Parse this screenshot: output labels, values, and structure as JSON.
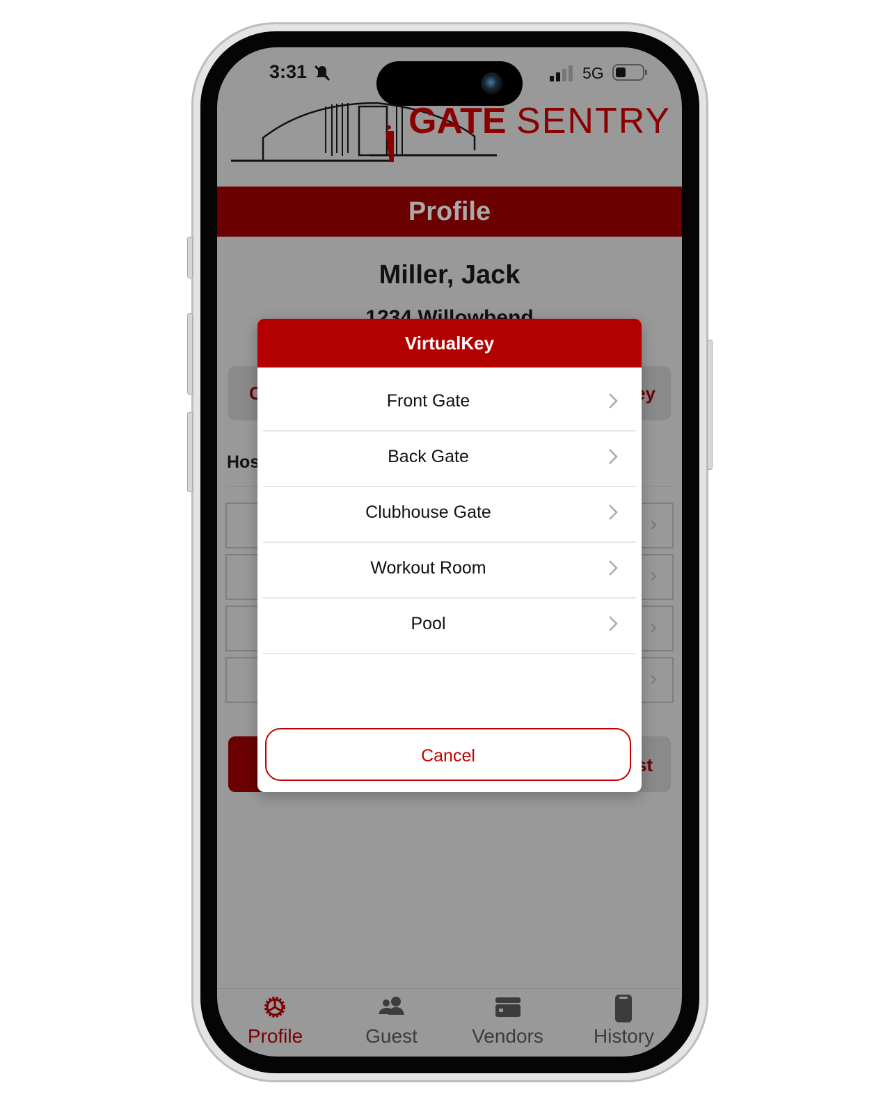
{
  "status_bar": {
    "time": "3:31",
    "network": "5G"
  },
  "logo": {
    "text_bold": "GATE",
    "text_light": "SENTRY"
  },
  "header": {
    "title": "Profile"
  },
  "profile": {
    "name": "Miller, Jack",
    "address": "1234 Willowbend"
  },
  "background_fragments": {
    "left_button": "C",
    "right_button": "ey",
    "section_label": "Hos",
    "bottom_button": "st"
  },
  "modal": {
    "title": "VirtualKey",
    "items": [
      {
        "label": "Front Gate"
      },
      {
        "label": "Back Gate"
      },
      {
        "label": "Clubhouse Gate"
      },
      {
        "label": "Workout Room"
      },
      {
        "label": "Pool"
      }
    ],
    "cancel_label": "Cancel"
  },
  "tabs": [
    {
      "label": "Profile",
      "icon": "gear-icon",
      "active": true
    },
    {
      "label": "Guest",
      "icon": "people-icon",
      "active": false
    },
    {
      "label": "Vendors",
      "icon": "card-icon",
      "active": false
    },
    {
      "label": "History",
      "icon": "clipboard-icon",
      "active": false
    }
  ],
  "colors": {
    "brand_dark": "#6b0000",
    "modal_header": "#b30000",
    "accent": "#c00000"
  }
}
